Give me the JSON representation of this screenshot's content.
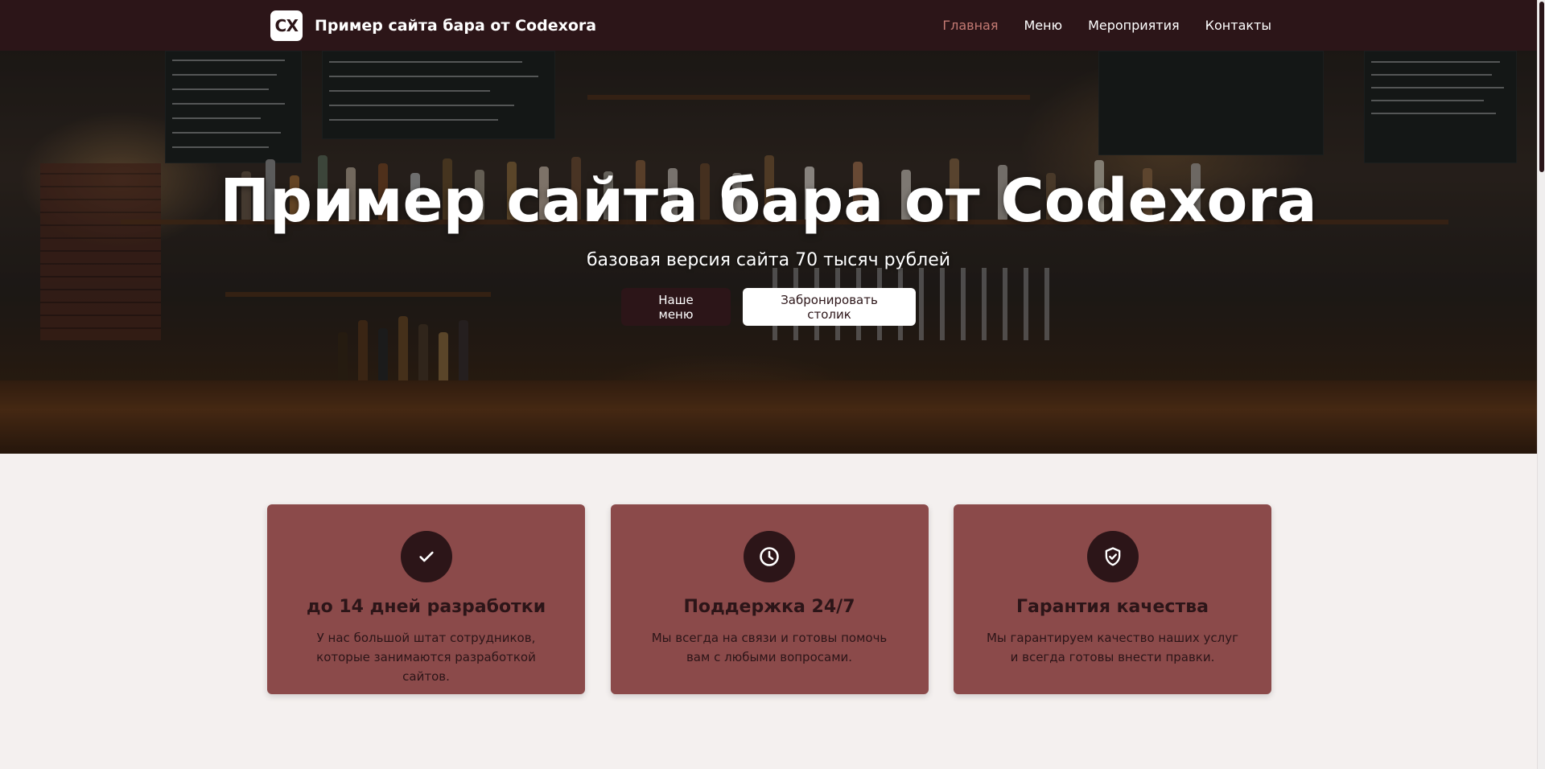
{
  "header": {
    "logo_text": "CX",
    "brand": "Пример сайта бара от Codexora",
    "nav": [
      {
        "label": "Главная",
        "active": true
      },
      {
        "label": "Меню",
        "active": false
      },
      {
        "label": "Мероприятия",
        "active": false
      },
      {
        "label": "Контакты",
        "active": false
      }
    ]
  },
  "hero": {
    "title": "Пример сайта бара от Codexora",
    "subtitle": "базовая версия сайта 70 тысяч рублей",
    "primary_button": "Наше меню",
    "secondary_button": "Забронировать столик"
  },
  "features": [
    {
      "icon": "check-icon",
      "title": "до 14 дней разработки",
      "text": "У нас большой штат сотрудников, которые занимаются разработкой сайтов."
    },
    {
      "icon": "clock-icon",
      "title": "Поддержка 24/7",
      "text": "Мы всегда на связи и готовы помочь вам с любыми вопросами."
    },
    {
      "icon": "shield-check-icon",
      "title": "Гарантия качества",
      "text": "Мы гарантируем качество наших услуг и всегда готовы внести правки."
    }
  ],
  "colors": {
    "header_bg": "#2c1518",
    "accent_active": "#c47a73",
    "card_bg": "#8b4a4a",
    "page_bg": "#f4f0ef"
  }
}
